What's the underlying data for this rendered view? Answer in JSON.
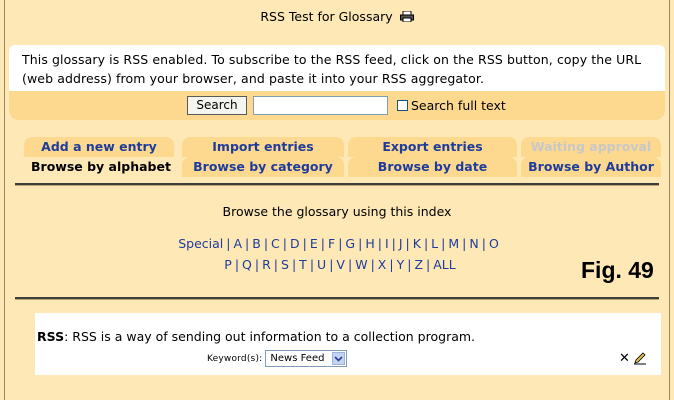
{
  "page": {
    "title": "RSS Test for Glossary",
    "intro_text": "This glossary is RSS enabled. To subscribe to the RSS feed, click on the RSS button, copy the URL (web address) from your browser, and paste it into your RSS aggregator.",
    "figure_label": "Fig. 49"
  },
  "search": {
    "button_label": "Search",
    "input_value": "",
    "fulltext_label": "Search full text"
  },
  "tabs_row1": [
    {
      "label": "Add a new entry"
    },
    {
      "label": "Import entries"
    },
    {
      "label": "Export entries"
    },
    {
      "label": "Waiting approval"
    }
  ],
  "tabs_row2": [
    {
      "label": "Browse by alphabet"
    },
    {
      "label": "Browse by category"
    },
    {
      "label": "Browse by date"
    },
    {
      "label": "Browse by Author"
    }
  ],
  "browse": {
    "hint": "Browse the glossary using this index",
    "line1": [
      "Special",
      "A",
      "B",
      "C",
      "D",
      "E",
      "F",
      "G",
      "H",
      "I",
      "J",
      "K",
      "L",
      "M",
      "N",
      "O"
    ],
    "line2": [
      "P",
      "Q",
      "R",
      "S",
      "T",
      "U",
      "V",
      "W",
      "X",
      "Y",
      "Z",
      "ALL"
    ]
  },
  "entry": {
    "concept": "RSS",
    "definition": ": RSS is a way of sending out information to a collection program.",
    "keyword_label": "Keyword(s):",
    "keyword_value": "News Feed"
  },
  "icons": {
    "printer": "printer-icon",
    "delete": "delete-icon",
    "edit": "edit-icon",
    "dropdown": "chevron-down-icon"
  },
  "colors": {
    "background": "#fde8b6",
    "tab": "#fdd98f",
    "link": "#1f3c9c",
    "disabled": "#c8c8c8"
  }
}
